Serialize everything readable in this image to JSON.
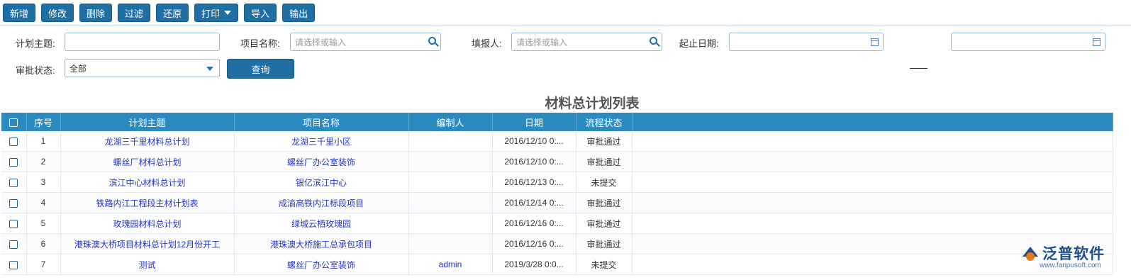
{
  "toolbar": {
    "add": "新增",
    "edit": "修改",
    "delete": "删除",
    "filter": "过滤",
    "restore": "还原",
    "print": "打印",
    "import": "导入",
    "export": "输出"
  },
  "filters": {
    "plan_subject_label": "计划主题:",
    "project_name_label": "项目名称:",
    "project_name_placeholder": "请选择或输入",
    "reporter_label": "填报人:",
    "reporter_placeholder": "请选择或输入",
    "date_range_label": "起止日期:",
    "approval_status_label": "审批状态:",
    "approval_status_value": "全部",
    "query_button": "查询"
  },
  "table": {
    "title": "材料总计划列表",
    "columns": [
      "序号",
      "计划主题",
      "项目名称",
      "编制人",
      "日期",
      "流程状态"
    ],
    "rows": [
      {
        "no": "1",
        "subject": "龙湖三千里材料总计划",
        "project": "龙湖三千里小区",
        "author": "",
        "date": "2016/12/10 0:...",
        "status": "审批通过"
      },
      {
        "no": "2",
        "subject": "螺丝厂材料总计划",
        "project": "螺丝厂办公室装饰",
        "author": "",
        "date": "2016/12/10 0:...",
        "status": "审批通过"
      },
      {
        "no": "3",
        "subject": "滨江中心材料总计划",
        "project": "银亿滨江中心",
        "author": "",
        "date": "2016/12/13 0:...",
        "status": "未提交"
      },
      {
        "no": "4",
        "subject": "铁路内江工程段主材计划表",
        "project": "成渝高铁内江标段项目",
        "author": "",
        "date": "2016/12/14 0:...",
        "status": "审批通过"
      },
      {
        "no": "5",
        "subject": "玫瑰园材料总计划",
        "project": "绿城云栖玫瑰园",
        "author": "",
        "date": "2016/12/16 0:...",
        "status": "审批通过"
      },
      {
        "no": "6",
        "subject": "港珠澳大桥项目材料总计划12月份开工",
        "project": "港珠澳大桥施工总承包项目",
        "author": "",
        "date": "2016/12/16 0:...",
        "status": "审批通过"
      },
      {
        "no": "7",
        "subject": "测试",
        "project": "螺丝厂办公室装饰",
        "author": "admin",
        "date": "2019/3/28 0:0...",
        "status": "未提交"
      }
    ]
  },
  "logo": {
    "name": "泛普软件",
    "url": "www.fanpusoft.com"
  }
}
